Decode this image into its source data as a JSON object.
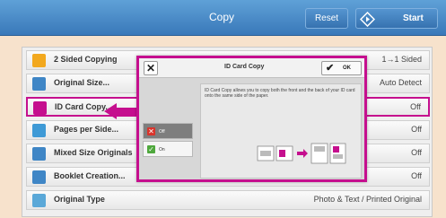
{
  "header": {
    "title": "Copy",
    "reset_label": "Reset",
    "start_label": "Start"
  },
  "features": [
    {
      "label": "2 Sided Copying",
      "value": "1→1 Sided",
      "icon": "two-sided-icon",
      "color": "#f2a81e"
    },
    {
      "label": "Original Size...",
      "value": "Auto Detect",
      "icon": "original-size-icon",
      "color": "#3f86c6"
    },
    {
      "label": "ID Card Copy...",
      "value": "Off",
      "icon": "id-card-icon",
      "color": "#c50f8e"
    },
    {
      "label": "Pages per Side...",
      "value": "Off",
      "icon": "pages-per-side-icon",
      "color": "#3f9ad6"
    },
    {
      "label": "Mixed Size Originals",
      "value": "Off",
      "icon": "mixed-size-icon",
      "color": "#3f86c6"
    },
    {
      "label": "Booklet Creation...",
      "value": "Off",
      "icon": "booklet-icon",
      "color": "#3f86c6"
    },
    {
      "label": "Original Type",
      "value": "Photo & Text / Printed Original",
      "icon": "original-type-icon",
      "color": "#5aa8d8"
    }
  ],
  "dialog": {
    "title": "ID Card Copy",
    "ok_label": "OK",
    "options": [
      {
        "label": "Off",
        "state": "selected"
      },
      {
        "label": "On",
        "state": "unselected"
      }
    ],
    "description": "ID Card Copy allows you to copy both the front and the back of your ID card onto the same side of the paper."
  },
  "colors": {
    "accent": "#c50f8e",
    "header_blue": "#3978b9",
    "background": "#f7e2cc"
  }
}
